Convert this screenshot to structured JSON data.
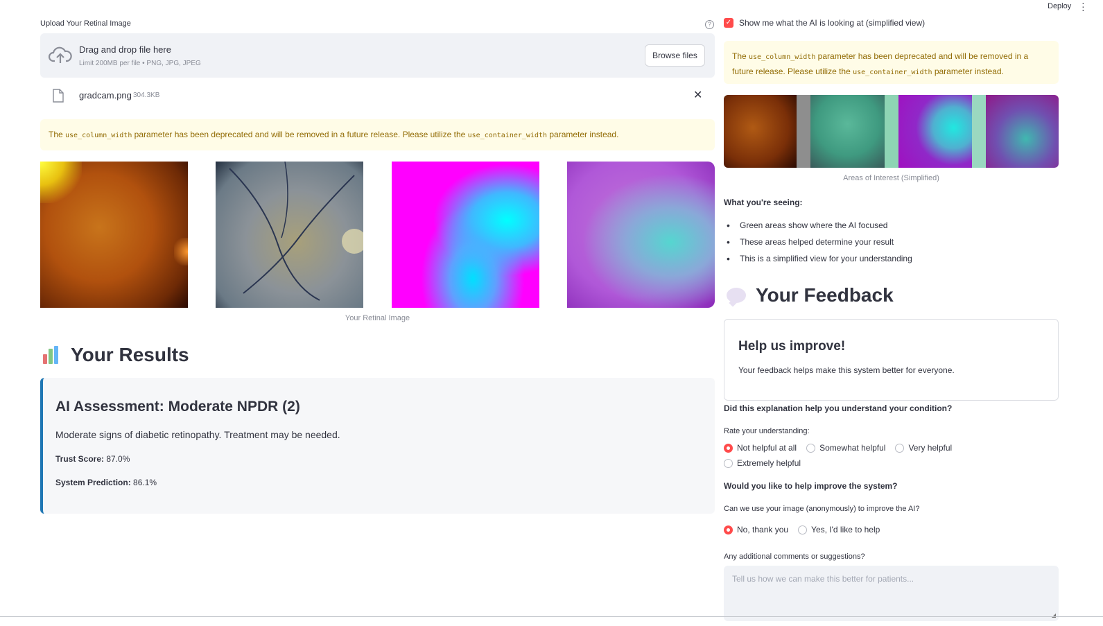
{
  "header": {
    "deploy_label": "Deploy",
    "menu_icon": "kebab-menu-icon"
  },
  "upload": {
    "label": "Upload Your Retinal Image",
    "dropzone_title": "Drag and drop file here",
    "dropzone_subtitle": "Limit 200MB per file • PNG, JPG, JPEG",
    "browse_label": "Browse files",
    "file_name": "gradcam.png",
    "file_size": "304.3KB"
  },
  "warning_left": {
    "prefix": "The ",
    "param1": "use_column_width",
    "middle": " parameter has been deprecated and will be removed in a future release. Please utilize the ",
    "param2": "use_container_width",
    "suffix": " parameter instead."
  },
  "images": {
    "caption": "Your Retinal Image"
  },
  "results": {
    "title": "Your Results",
    "assessment": "AI Assessment: Moderate NPDR (2)",
    "description": "Moderate signs of diabetic retinopathy. Treatment may be needed.",
    "trust_label": "Trust Score:",
    "trust_value": "87.0%",
    "prediction_label": "System Prediction:",
    "prediction_value": "86.1%"
  },
  "right": {
    "checkbox_label": "Show me what the AI is looking at (simplified view)",
    "warning": {
      "line1_prefix": "The ",
      "param1": "use_column_width",
      "line1_suffix": " parameter has been deprecated and will be removed in a",
      "line2_prefix": "future release. Please utilize the ",
      "param2": "use_container_width",
      "line2_suffix": " parameter instead."
    },
    "interest_caption": "Areas of Interest (Simplified)",
    "seeing_title": "What you're seeing:",
    "seeing_items": [
      "Green areas show where the AI focused",
      "These areas helped determine your result",
      "This is a simplified view for your understanding"
    ]
  },
  "feedback": {
    "title": "Your Feedback",
    "card_title": "Help us improve!",
    "card_text": "Your feedback helps make this system better for everyone.",
    "q1": "Did this explanation help you understand your condition?",
    "rate_label": "Rate your understanding:",
    "rate_options": [
      "Not helpful at all",
      "Somewhat helpful",
      "Very helpful",
      "Extremely helpful"
    ],
    "rate_selected": "Not helpful at all",
    "q2": "Would you like to help improve the system?",
    "consent_label": "Can we use your image (anonymously) to improve the AI?",
    "consent_options": [
      "No, thank you",
      "Yes, I'd like to help"
    ],
    "consent_selected": "No, thank you",
    "comments_label": "Any additional comments or suggestions?",
    "comments_placeholder": "Tell us how we can make this better for patients..."
  },
  "colors": {
    "accent": "#ff4b4b",
    "result_border": "#1f77b4",
    "warning_bg": "#fffce7",
    "warning_text": "#926c05"
  }
}
